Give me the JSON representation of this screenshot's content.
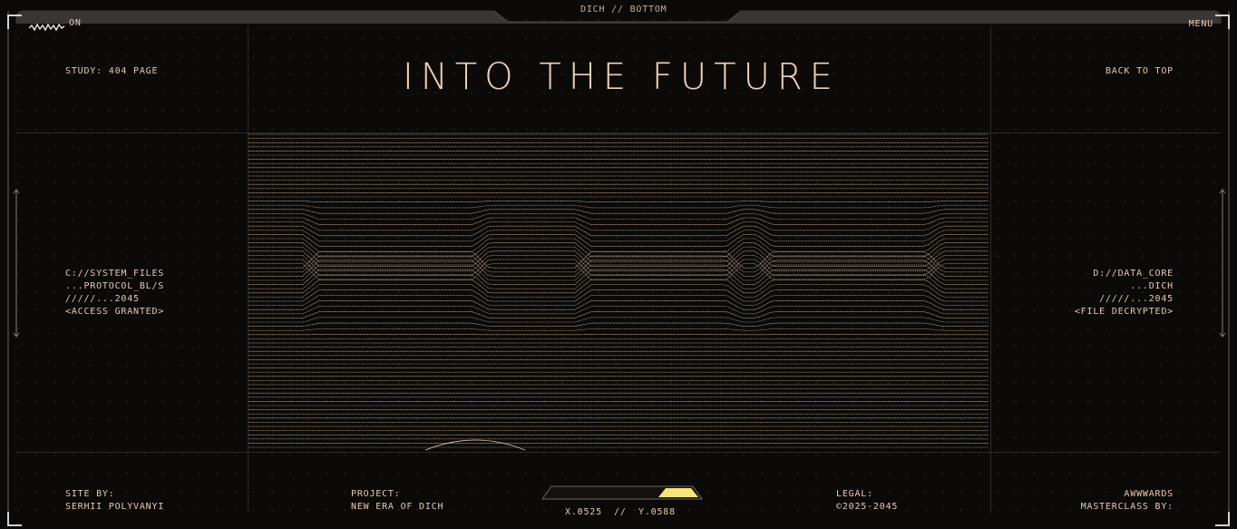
{
  "top": {
    "center": "DICH // BOTTOM",
    "left_toggle": "ON",
    "menu": "MENU"
  },
  "header": {
    "study": "STUDY: 404 PAGE",
    "title": "INTO THE FUTURE",
    "back_to_top": "BACK TO TOP"
  },
  "left_info": [
    "C://SYSTEM_FILES",
    "...PROTOCOL_BL/S",
    "/////...2045",
    "<ACCESS GRANTED>"
  ],
  "right_info": [
    "D://DATA_CORE",
    "...DICH",
    "/////...2045",
    "<FILE DECRYPTED>"
  ],
  "footer": {
    "site_by_label": "SITE BY:",
    "site_by_value": "SERHII POLYVANYI",
    "project_label": "PROJECT:",
    "project_value": "NEW ERA OF DICH",
    "legal_label": "LEGAL:",
    "legal_value": "©2025-2045",
    "awwwards_label": "AWWWARDS",
    "masterclass_label": "MASTERCLASS BY:",
    "coord_x": "X.0525",
    "coord_sep": "//",
    "coord_y": "Y.0588"
  },
  "colors": {
    "accent": "#e8c9a8",
    "highlight": "#f7e57a",
    "background": "#0b0a09",
    "line": "#2e2b29"
  }
}
